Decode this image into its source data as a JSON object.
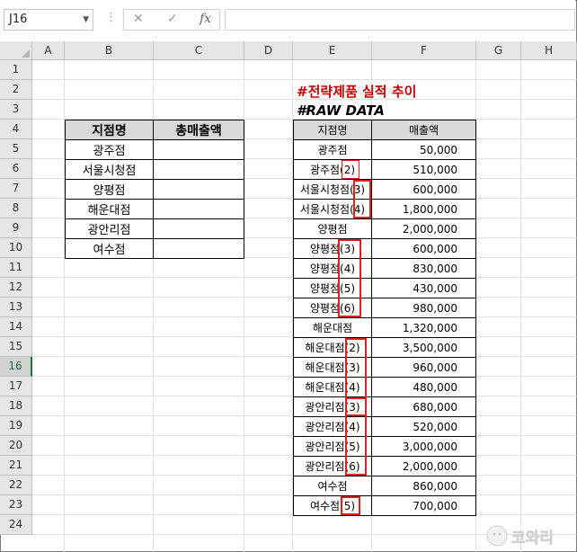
{
  "formula_bar": {
    "cell_ref": "J16",
    "fx_symbol": "fx",
    "cancel_symbol": "✕",
    "enter_symbol": "✓",
    "formula": ""
  },
  "columns": [
    "A",
    "B",
    "C",
    "D",
    "E",
    "F",
    "G",
    "H"
  ],
  "rows": [
    "1",
    "2",
    "3",
    "4",
    "5",
    "6",
    "7",
    "8",
    "9",
    "10",
    "11",
    "12",
    "13",
    "14",
    "15",
    "16",
    "17",
    "18",
    "19",
    "20",
    "21",
    "22",
    "23",
    "24"
  ],
  "active_row": "16",
  "title": "#전략제품 실적 추이",
  "subtitle": "#RAW DATA",
  "summary_table": {
    "headers": [
      "지점명",
      "총매출액"
    ],
    "rows": [
      {
        "name": "광주점",
        "total": ""
      },
      {
        "name": "서울시청점",
        "total": ""
      },
      {
        "name": "양평점",
        "total": ""
      },
      {
        "name": "해운대점",
        "total": ""
      },
      {
        "name": "광안리점",
        "total": ""
      },
      {
        "name": "여수점",
        "total": ""
      }
    ]
  },
  "raw_table": {
    "headers": [
      "지점명",
      "매출액"
    ],
    "rows": [
      {
        "name": "광주점",
        "amount": "50,000"
      },
      {
        "name": "광주점(2)",
        "amount": "510,000"
      },
      {
        "name": "서울시청점(3)",
        "amount": "600,000"
      },
      {
        "name": "서울시청점(4)",
        "amount": "1,800,000"
      },
      {
        "name": "양평점",
        "amount": "2,000,000"
      },
      {
        "name": "양평점(3)",
        "amount": "600,000"
      },
      {
        "name": "양평점(4)",
        "amount": "830,000"
      },
      {
        "name": "양평점(5)",
        "amount": "430,000"
      },
      {
        "name": "양평점(6)",
        "amount": "980,000"
      },
      {
        "name": "해운대점",
        "amount": "1,320,000"
      },
      {
        "name": "해운대점(2)",
        "amount": "3,500,000"
      },
      {
        "name": "해운대점(3)",
        "amount": "960,000"
      },
      {
        "name": "해운대점(4)",
        "amount": "480,000"
      },
      {
        "name": "광안리점(3)",
        "amount": "680,000"
      },
      {
        "name": "광안리점(4)",
        "amount": "520,000"
      },
      {
        "name": "광안리점(5)",
        "amount": "3,000,000"
      },
      {
        "name": "광안리점(6)",
        "amount": "2,000,000"
      },
      {
        "name": "여수점",
        "amount": "860,000"
      },
      {
        "name": "여수점(5)",
        "amount": "700,000"
      }
    ]
  },
  "watermark": "코와리",
  "highlight_color": "#e02020",
  "title_color": "#c00000",
  "header_fill": "#d9d9d9"
}
